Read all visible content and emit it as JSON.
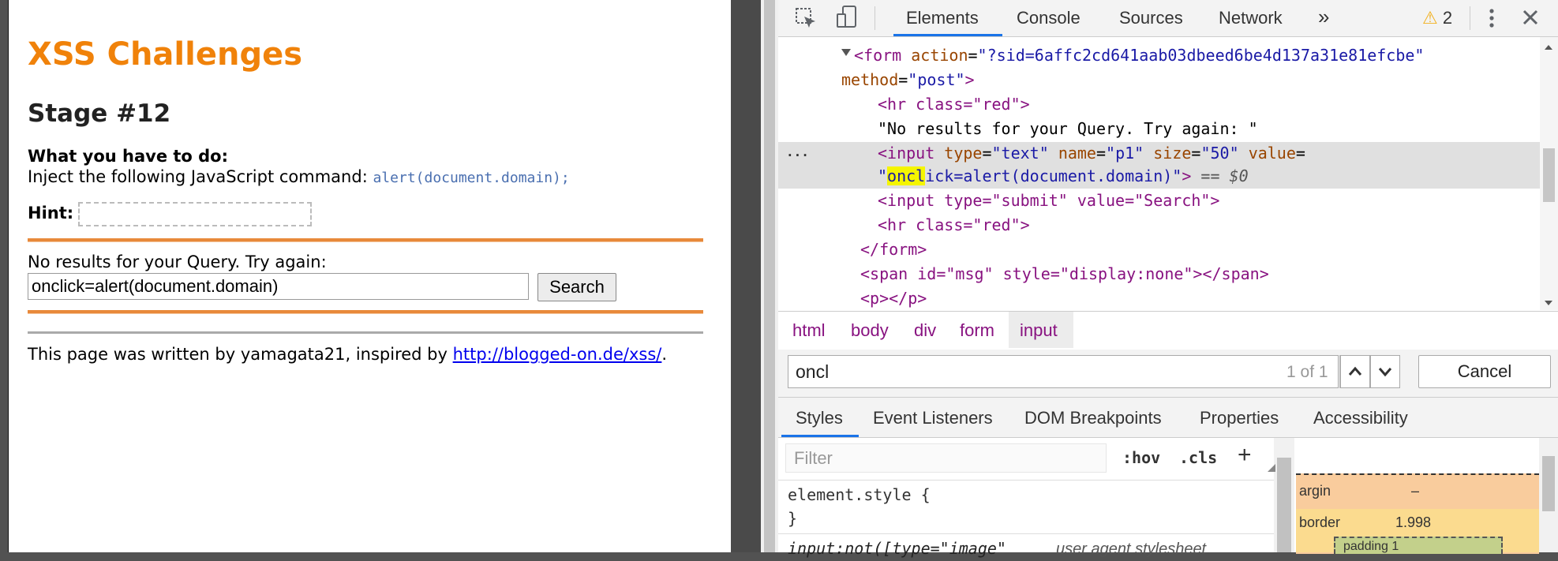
{
  "page": {
    "title": "XSS Challenges",
    "stage": "Stage #12",
    "what_heading": "What you have to do:",
    "inject_text": "Inject the following JavaScript command:",
    "inject_code": "alert(document.domain);",
    "hint_label": "Hint:",
    "no_results": "No results for your Query. Try again:",
    "query_value": "onclick=alert(document.domain)",
    "search_label": "Search",
    "footer_text": "This page was written by yamagata21, inspired by",
    "footer_link": "http://blogged-on.de/xss/",
    "footer_end": "."
  },
  "devtools": {
    "tabs": [
      "Elements",
      "Console",
      "Sources",
      "Network"
    ],
    "more_tabs": "»",
    "warnings_count": "2",
    "dom_lines": {
      "form_open_a": "<form ",
      "form_action_attr": "action",
      "form_action_val": "\"?sid=6affc2cd641aab03dbeed6be4d137a31e81efcbe\"",
      "form_method_attr": "method",
      "form_method_val": "\"post\"",
      "hr_red": "<hr class=\"red\">",
      "text_node": "\"No results for your Query. Try again: \"",
      "input_text_a": "<input ",
      "input_type_attr": "type",
      "input_type_val": "\"text\"",
      "input_name_attr": "name",
      "input_name_val": "\"p1\"",
      "input_size_attr": "size",
      "input_size_val": "\"50\"",
      "input_value_attr": "value",
      "value_quote_open": "\"",
      "value_match": "oncl",
      "value_rest": "ick=alert(document.domain)\"",
      "eq_dollar": "== $0",
      "input_submit": "<input type=\"submit\" value=\"Search\">",
      "hr_red_2": "<hr class=\"red\">",
      "form_close": "</form>",
      "span_line": "<span id=\"msg\" style=\"display:none\"></span>",
      "p_line": "<p></p>",
      "ellipsis": "..."
    },
    "breadcrumbs": [
      "html",
      "body",
      "div",
      "form",
      "input"
    ],
    "search": {
      "query": "oncl",
      "match_count": "1 of 1",
      "cancel_label": "Cancel"
    },
    "subtabs": [
      "Styles",
      "Event Listeners",
      "DOM Breakpoints",
      "Properties",
      "Accessibility"
    ],
    "styles": {
      "filter_placeholder": "Filter",
      "hov": ":hov",
      "cls": ".cls",
      "plus": "+",
      "element_style": "element.style {",
      "close_brace": "}",
      "next_rule": "input:not([type=\"image\"",
      "next_source": "user agent stylesheet"
    },
    "box_model": {
      "margin_label": "argin",
      "margin_value": "–",
      "border_label": "border",
      "border_value": "1.998",
      "padding_label": "padding 1"
    }
  }
}
